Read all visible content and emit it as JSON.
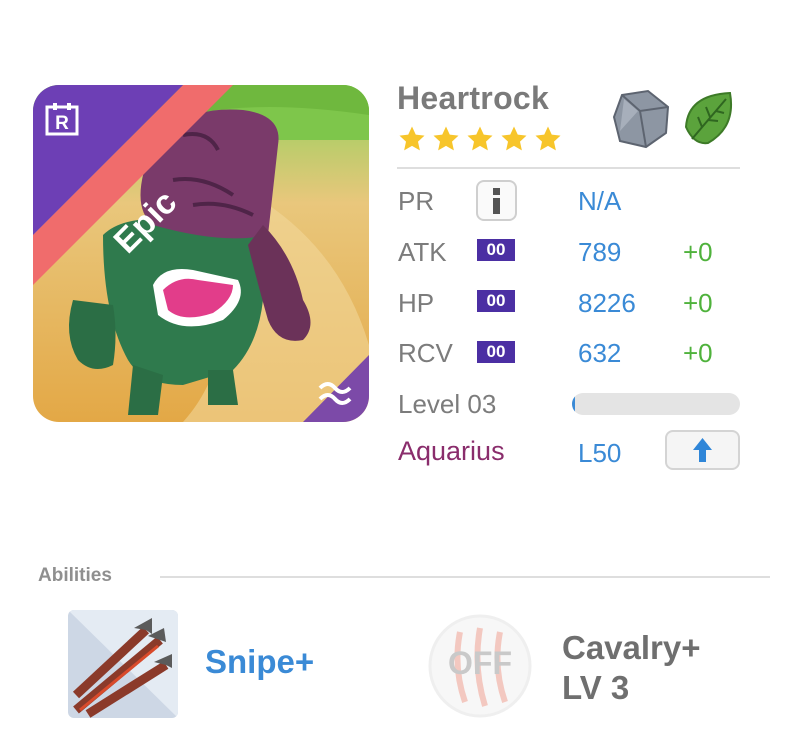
{
  "monster": {
    "name": "Heartrock",
    "rarity": "Epic",
    "stars": 5,
    "elements": [
      "rock-icon",
      "leaf-icon"
    ],
    "badge_icon": "r-icon",
    "evolve_icon": "wave-icon"
  },
  "stats": {
    "pr": {
      "label": "PR",
      "value": "N/A"
    },
    "atk": {
      "label": "ATK",
      "tag": "00",
      "value": "789",
      "bonus": "+0"
    },
    "hp": {
      "label": "HP",
      "tag": "00",
      "value": "8226",
      "bonus": "+0"
    },
    "rcv": {
      "label": "RCV",
      "tag": "00",
      "value": "632",
      "bonus": "+0"
    }
  },
  "level": {
    "label": "Level 03",
    "progress": 0.01
  },
  "constellation": {
    "name": "Aquarius",
    "level": "L50"
  },
  "abilities": {
    "title": "Abilities",
    "items": [
      {
        "name": "Snipe+",
        "icon": "snipe-arrows-icon",
        "state": "on"
      },
      {
        "name_line1": "Cavalry+",
        "name_line2": "LV 3",
        "icon": "claw-icon",
        "state": "OFF"
      }
    ]
  },
  "colors": {
    "accent_blue": "#3a8ad6",
    "bonus_green": "#4fb23c",
    "tag_purple": "#4b2fa3",
    "constellation_purple": "#8a2d6c",
    "epic_banner": "#f06c6c",
    "badge_purple": "#6d3fb5"
  }
}
